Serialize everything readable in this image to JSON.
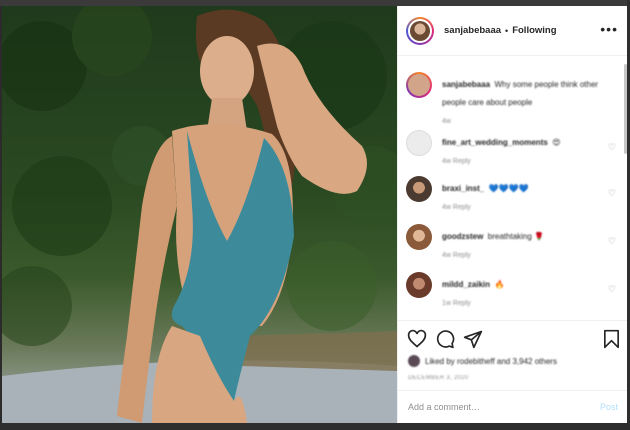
{
  "post": {
    "photo_icon": "photo-of-person",
    "header": {
      "username": "sanjabebaaa",
      "separator": "•",
      "follow_status": "Following",
      "more_icon": "ellipsis-icon",
      "more_label": "•••"
    },
    "comments": [
      {
        "username": "sanjabebaaa",
        "text": "Why some people think other people care about people",
        "meta": "4w",
        "avatar_color": "#d2a58a"
      },
      {
        "username": "fine_art_wedding_moments",
        "text": "😍",
        "meta": "4w   Reply",
        "avatar_color": "#e6e6e6"
      },
      {
        "username": "braxi_inst_",
        "text": "💙💙💙💙",
        "meta": "4w   Reply",
        "avatar_color": "#7a6a5a"
      },
      {
        "username": "goodzstew",
        "text": "breathtaking 🌹",
        "meta": "4w   Reply",
        "avatar_color": "#c49a7a"
      },
      {
        "username": "mildd_zaikin",
        "text": "🔥",
        "meta": "1w   Reply",
        "avatar_color": "#9a6a5a"
      }
    ],
    "actions": {
      "like_icon": "heart-icon",
      "comment_icon": "comment-bubble-icon",
      "share_icon": "paper-plane-icon",
      "save_icon": "bookmark-icon"
    },
    "likes_text": "Liked by rodebitheff and 3,942 others",
    "date_text": "DECEMBER 3, 2020",
    "add_comment": {
      "placeholder": "Add a comment…",
      "post_label": "Post"
    },
    "colors": {
      "accent_ring": "#dd2a7b",
      "post_disabled": "#b2dffc",
      "text": "#262626",
      "muted": "#8e8e8e"
    }
  }
}
